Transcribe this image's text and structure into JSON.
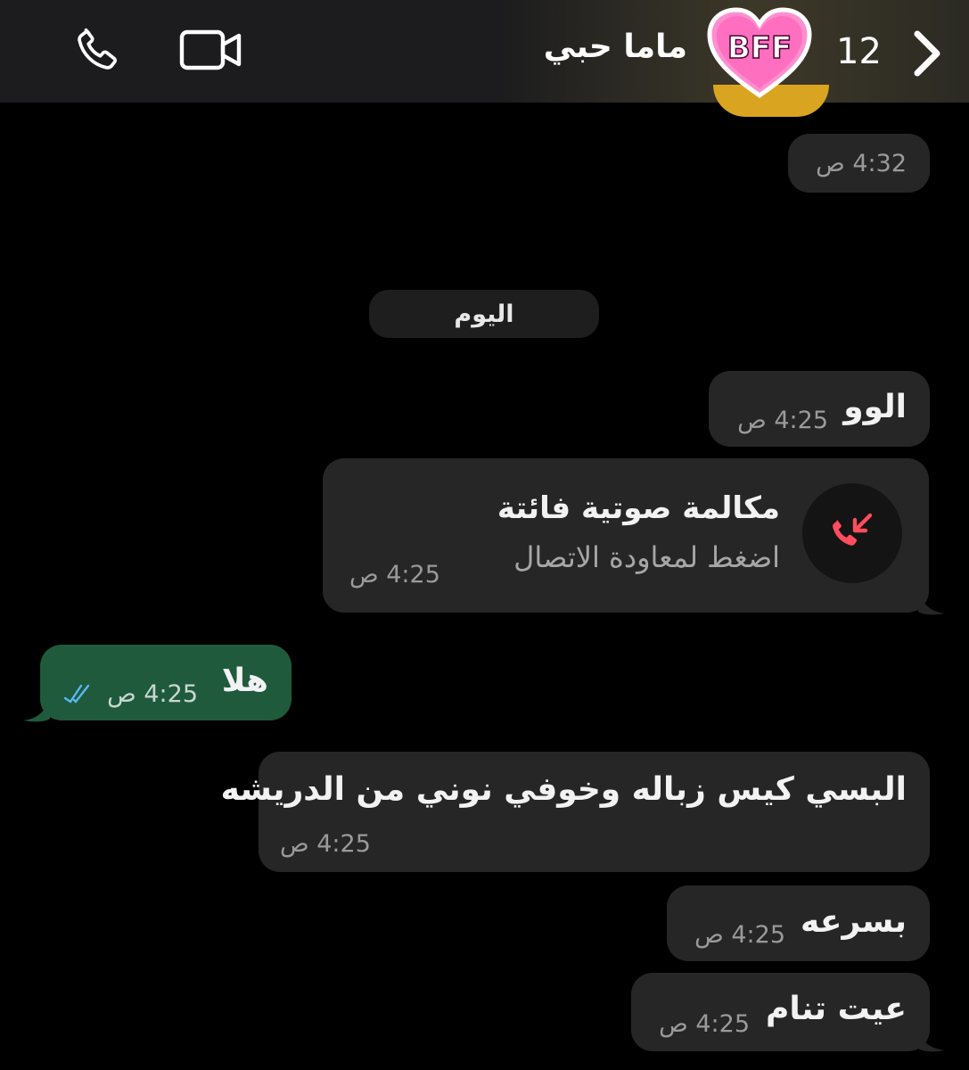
{
  "header": {
    "contact_name": "ماما حبي",
    "unread_count": "12",
    "avatar_text": "BFF",
    "icons": {
      "back": "chevron-right-icon",
      "phone": "phone-icon",
      "video": "video-camera-icon"
    }
  },
  "messages": {
    "top_time": "4:32 ص",
    "date_divider": "اليوم",
    "m1": {
      "text": "الوو",
      "time": "4:25 ص"
    },
    "missed_call": {
      "title": "مكالمة صوتية فائتة",
      "subtitle": "اضغط لمعاودة الاتصال",
      "time": "4:25 ص",
      "icon": "missed-call-icon"
    },
    "m2": {
      "text": "هلا",
      "time": "4:25 ص",
      "status": "read"
    },
    "m3": {
      "text": "البسي كيس زباله وخوفي نوني من الدريشه",
      "time": "4:25 ص"
    },
    "m4": {
      "text": "بسرعه",
      "time": "4:25 ص"
    },
    "m5": {
      "text": "عيت تنام",
      "time": "4:25 ص"
    }
  },
  "colors": {
    "background": "#000000",
    "header": "#1c1c1e",
    "incoming_bubble": "#262626",
    "outgoing_bubble": "#1f5a3d",
    "missed_call": "#ff4d5e",
    "read_ticks": "#58b8f0",
    "avatar_pink": "#ff8fcf"
  }
}
